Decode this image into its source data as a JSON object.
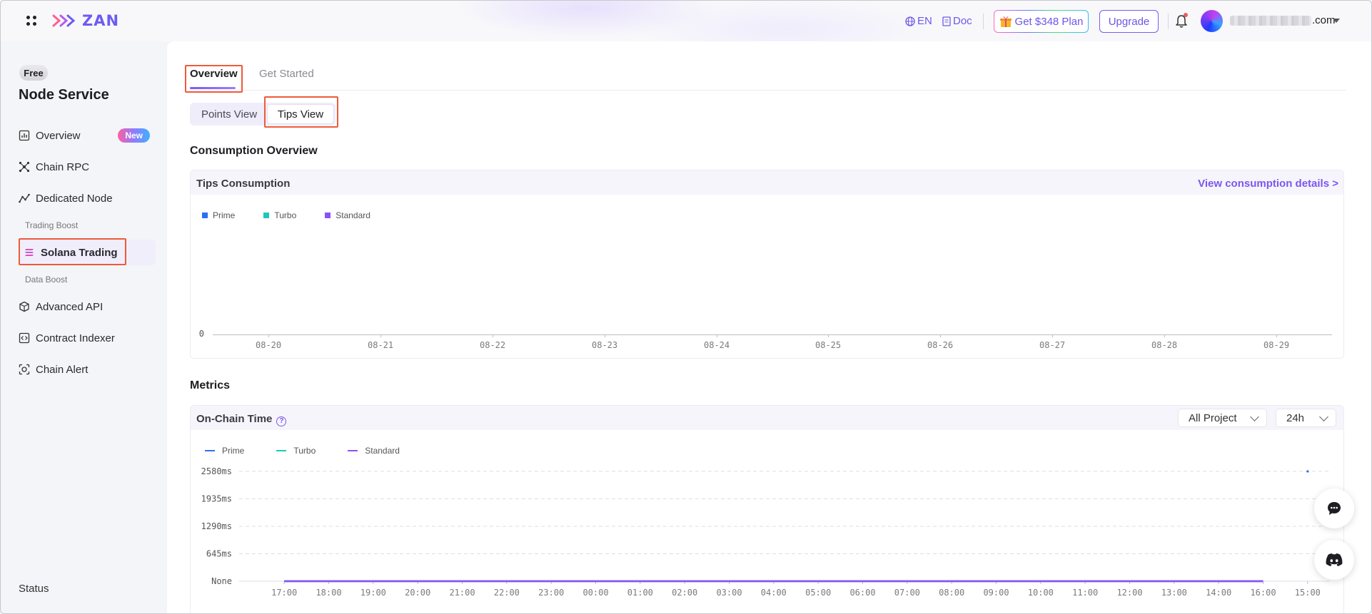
{
  "header": {
    "logo_text": "ZAN",
    "lang": "EN",
    "doc": "Doc",
    "plan_button": "Get $348 Plan",
    "upgrade_button": "Upgrade",
    "email_suffix": ".com"
  },
  "sidebar": {
    "plan_badge": "Free",
    "title": "Node Service",
    "items": [
      {
        "label": "Overview",
        "badge": "New",
        "icon": "bar-chart-icon"
      },
      {
        "label": "Chain RPC",
        "icon": "network-icon"
      },
      {
        "label": "Dedicated Node",
        "icon": "line-graph-icon"
      },
      {
        "label": "Solana Trading",
        "icon": "solana-icon",
        "active": true
      },
      {
        "label": "Advanced API",
        "icon": "cube-icon"
      },
      {
        "label": "Contract Indexer",
        "icon": "code-box-icon"
      },
      {
        "label": "Chain Alert",
        "icon": "alert-scan-icon"
      }
    ],
    "groups": [
      "Trading Boost",
      "Data Boost"
    ],
    "status": "Status"
  },
  "main": {
    "tabs": [
      {
        "label": "Overview",
        "active": true
      },
      {
        "label": "Get Started",
        "active": false
      }
    ],
    "view_toggle": [
      {
        "label": "Points View",
        "active": false
      },
      {
        "label": "Tips View",
        "active": true
      }
    ],
    "consumption": {
      "section_title": "Consumption Overview",
      "card_title": "Tips Consumption",
      "link": "View consumption details >"
    },
    "metrics": {
      "section_title": "Metrics",
      "card_title": "On-Chain Time",
      "help_icon": "?",
      "project_select": "All Project",
      "range_select": "24h"
    }
  },
  "colors": {
    "accent": "#7b57f0",
    "prime": "#2f6df6",
    "turbo": "#1fc7b8",
    "standard": "#8b52f2",
    "highlight": "#ee5a3a"
  },
  "chart_data": [
    {
      "type": "bar",
      "legend": [
        "Prime",
        "Turbo",
        "Standard"
      ],
      "categories": [
        "08-20",
        "08-21",
        "08-22",
        "08-23",
        "08-24",
        "08-25",
        "08-26",
        "08-27",
        "08-28",
        "08-29"
      ],
      "y_ticks": [
        "0"
      ],
      "series": [
        {
          "name": "Prime",
          "values": [
            0,
            0,
            0,
            0,
            0,
            0,
            0,
            0,
            0,
            0
          ]
        },
        {
          "name": "Turbo",
          "values": [
            0,
            0,
            0,
            0,
            0,
            0,
            0,
            0,
            0,
            0
          ]
        },
        {
          "name": "Standard",
          "values": [
            0,
            0,
            0,
            0,
            0,
            0,
            0,
            0,
            0,
            0
          ]
        }
      ],
      "legend_position": "top-left",
      "grid": false
    },
    {
      "type": "line",
      "legend": [
        "Prime",
        "Turbo",
        "Standard"
      ],
      "categories": [
        "17:00",
        "18:00",
        "19:00",
        "20:00",
        "21:00",
        "22:00",
        "23:00",
        "00:00",
        "01:00",
        "02:00",
        "03:00",
        "04:00",
        "05:00",
        "06:00",
        "07:00",
        "08:00",
        "09:00",
        "10:00",
        "11:00",
        "12:00",
        "13:00",
        "14:00",
        "16:00",
        "15:00"
      ],
      "y_ticks": [
        "None",
        "645ms",
        "1290ms",
        "1935ms",
        "2580ms"
      ],
      "ylim": [
        0,
        2580
      ],
      "series": [
        {
          "name": "Prime",
          "values": [
            0,
            0,
            0,
            0,
            0,
            0,
            0,
            0,
            0,
            0,
            0,
            0,
            0,
            0,
            0,
            0,
            0,
            0,
            0,
            0,
            0,
            0,
            0,
            2580
          ]
        },
        {
          "name": "Standard",
          "values": [
            0,
            0,
            0,
            0,
            0,
            0,
            0,
            0,
            0,
            0,
            0,
            0,
            0,
            0,
            0,
            0,
            0,
            0,
            0,
            0,
            0,
            0,
            0,
            null
          ]
        }
      ],
      "legend_position": "top-left",
      "grid": true
    }
  ]
}
